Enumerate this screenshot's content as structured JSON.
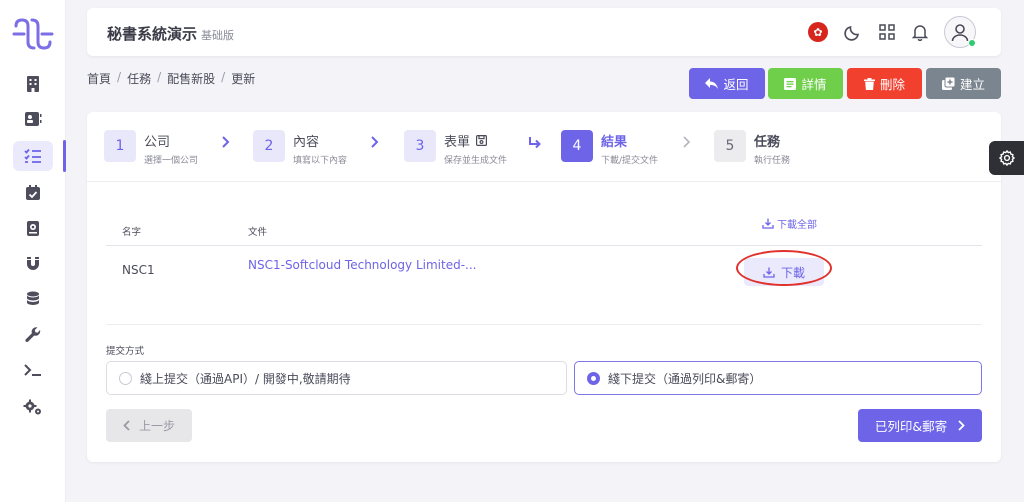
{
  "header": {
    "title": "秘書系統演示",
    "edition": "基础版",
    "icons": [
      "hk-flag-icon",
      "moon-icon",
      "grid-icon",
      "bell-icon",
      "user-avatar-icon"
    ]
  },
  "sidebar": {
    "icons": [
      "building-icon",
      "contact-card-icon",
      "task-list-icon",
      "calendar-check-icon",
      "book-icon",
      "magnet-icon",
      "database-icon",
      "wrench-icon",
      "terminal-icon",
      "gears-icon"
    ],
    "active_index": 2
  },
  "breadcrumb": {
    "items": [
      "首頁",
      "任務",
      "配售新股",
      "更新"
    ],
    "separator": "/"
  },
  "actions": {
    "back": "返回",
    "detail": "詳情",
    "delete": "刪除",
    "create": "建立"
  },
  "steps": [
    {
      "num": "1",
      "title": "公司",
      "sub": "選擇一個公司",
      "state": "done"
    },
    {
      "num": "2",
      "title": "內容",
      "sub": "填寫以下內容",
      "state": "done"
    },
    {
      "num": "3",
      "title": "表單",
      "sub": "保存並生成文件",
      "state": "done"
    },
    {
      "num": "4",
      "title": "結果",
      "sub": "下載/提交文件",
      "state": "current"
    },
    {
      "num": "5",
      "title": "任務",
      "sub": "執行任務",
      "state": "pending"
    }
  ],
  "table": {
    "headers": {
      "name": "名字",
      "file": "文件"
    },
    "download_all": "下載全部",
    "rows": [
      {
        "name": "NSC1",
        "file": "NSC1-Softcloud Technology Limited-...",
        "action": "下載"
      }
    ]
  },
  "submission": {
    "label": "提交方式",
    "options": [
      {
        "label": "綫上提交（通過API）/ 開發中,敬請期待",
        "selected": false
      },
      {
        "label": "綫下提交（通過列印&郵寄）",
        "selected": true
      }
    ]
  },
  "nav": {
    "prev": "上一步",
    "next": "已列印&郵寄"
  },
  "colors": {
    "primary": "#6d64e8",
    "success": "#6fcf4b",
    "danger": "#f2402f",
    "secondary": "#7b858f"
  }
}
